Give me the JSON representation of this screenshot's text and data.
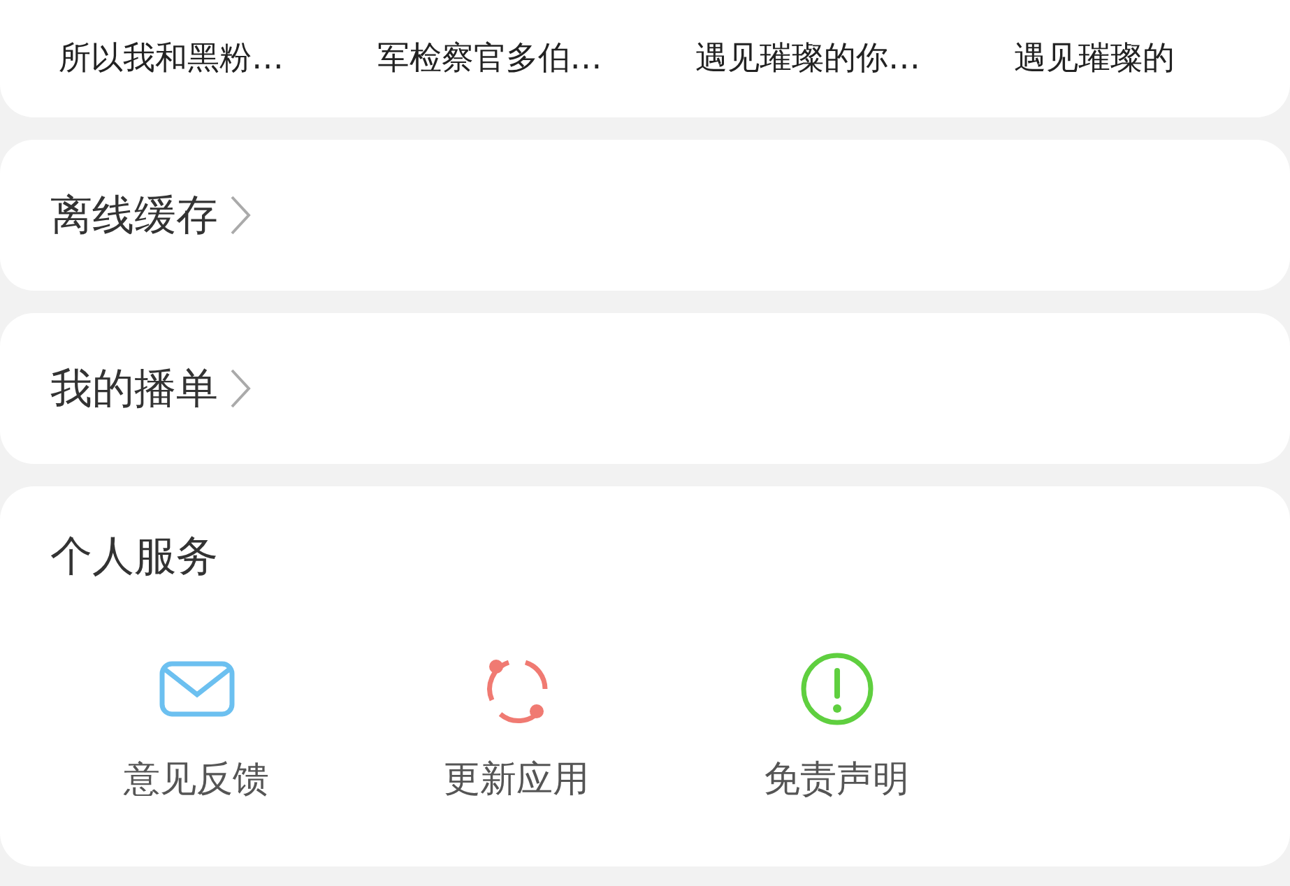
{
  "recent_titles": [
    "所以我和黑粉…",
    "军检察官多伯…",
    "遇见璀璨的你…",
    "遇见璀璨的"
  ],
  "entries": [
    "离线缓存",
    "我的播单"
  ],
  "services": {
    "title": "个人服务",
    "items": [
      {
        "kind": "mail",
        "label": "意见反馈"
      },
      {
        "kind": "update",
        "label": "更新应用"
      },
      {
        "kind": "notice",
        "label": "免责声明"
      }
    ]
  }
}
